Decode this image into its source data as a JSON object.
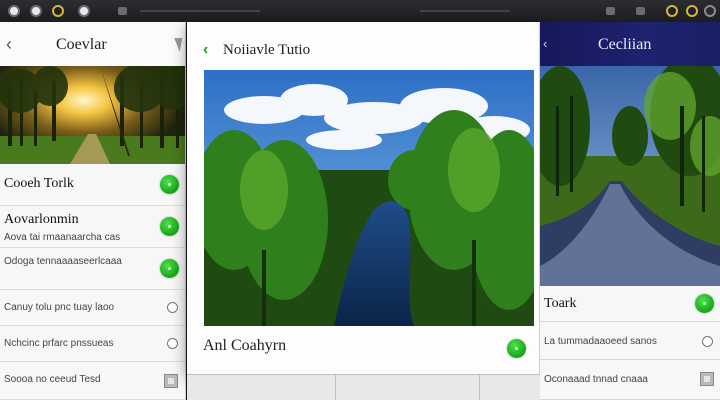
{
  "left_panel": {
    "title": "Coevlar",
    "rows": [
      {
        "title": "Cooeh Torlk",
        "subtitle": ""
      },
      {
        "title": "Aovarlonmin",
        "subtitle": "Aova tai rmaanaarcha cas"
      },
      {
        "title": "",
        "subtitle": "Odoga tennaaaaseerlcaaa"
      },
      {
        "title": "",
        "subtitle": "Canuy tolu pnc tuay laoo"
      },
      {
        "title": "",
        "subtitle": "Nchcinc prfarc pnssueas"
      },
      {
        "title": "",
        "subtitle": "Soooa no ceeud Tesd"
      }
    ]
  },
  "center_panel": {
    "title": "Noiiavle Tutio",
    "footer_text": "Anl Coahyrn"
  },
  "right_panel": {
    "title": "Cecliian",
    "rows": [
      {
        "title": "Toark",
        "subtitle": ""
      },
      {
        "title": "",
        "subtitle": "La tummadaaoeed sanos"
      },
      {
        "title": "",
        "subtitle": "Oconaaad tnnad cnaaa"
      }
    ]
  },
  "colors": {
    "accent_green": "#15a515",
    "right_header": "#1e2370"
  }
}
